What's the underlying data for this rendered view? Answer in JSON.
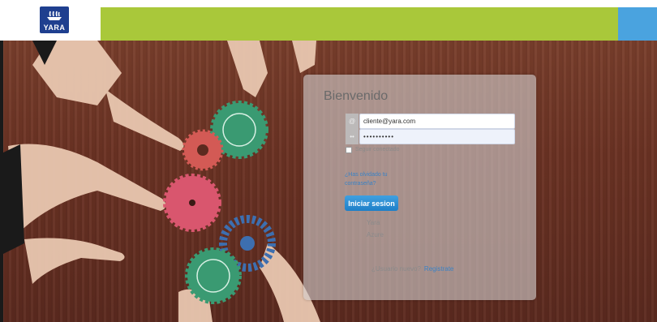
{
  "brand": {
    "name": "YARA",
    "colors": {
      "header_green": "#a9c83a",
      "header_blue": "#4aa3df",
      "logo_blue": "#1f3f8f"
    }
  },
  "login": {
    "title": "Bienvenido",
    "email_value": "cliente@yara.com",
    "password_value": "••••••••••",
    "remember_label": "Seguir conectado",
    "forgot_link": "¿Has olvidado tu contraseña?",
    "submit_label": "Iniciar sesion",
    "providers": [
      "Yara",
      "Azure"
    ],
    "register_prompt": "¿Usuario nuevo?",
    "register_link": "Registrate"
  },
  "icons": {
    "email": "at-icon",
    "password": "key-icon",
    "logo": "viking-ship-icon"
  }
}
